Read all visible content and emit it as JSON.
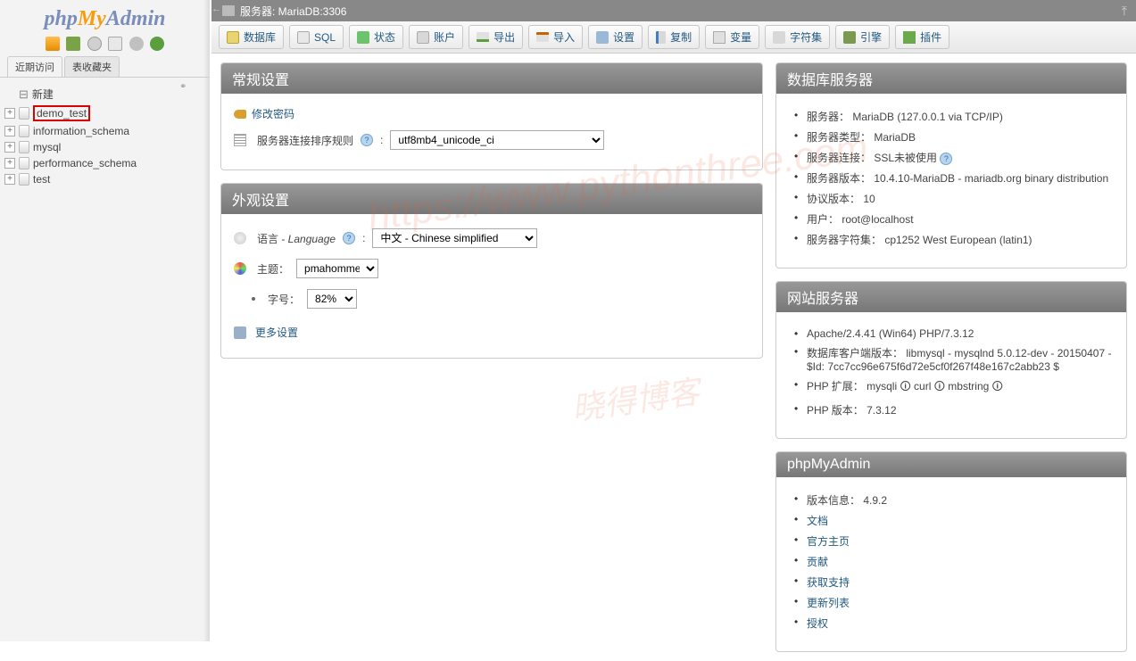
{
  "logo": {
    "php": "php",
    "my": "My",
    "admin": "Admin"
  },
  "sidebar": {
    "tabs": {
      "recent": "近期访问",
      "favorites": "表收藏夹"
    },
    "new": "新建",
    "databases": [
      "demo_test",
      "information_schema",
      "mysql",
      "performance_schema",
      "test"
    ]
  },
  "breadcrumb": {
    "server_label": "服务器: MariaDB:3306"
  },
  "topnav": {
    "databases": "数据库",
    "sql": "SQL",
    "status": "状态",
    "users": "账户",
    "export": "导出",
    "import": "导入",
    "settings": "设置",
    "replication": "复制",
    "variables": "变量",
    "charsets": "字符集",
    "engines": "引擎",
    "plugins": "插件"
  },
  "general": {
    "title": "常规设置",
    "change_password": "修改密码",
    "collation_label": "服务器连接排序规则",
    "collation_value": "utf8mb4_unicode_ci"
  },
  "appearance": {
    "title": "外观设置",
    "language_label": "语言 - ",
    "language_label2": "Language",
    "language_value": "中文 - Chinese simplified",
    "theme_label": "主题：",
    "theme_value": "pmahomme",
    "fontsize_label": "字号：",
    "fontsize_value": "82%",
    "more_settings": "更多设置"
  },
  "dbserver": {
    "title": "数据库服务器",
    "items": [
      "服务器： MariaDB (127.0.0.1 via TCP/IP)",
      "服务器类型： MariaDB",
      "服务器连接： SSL未被使用",
      "服务器版本： 10.4.10-MariaDB - mariadb.org binary distribution",
      "协议版本： 10",
      "用户： root@localhost",
      "服务器字符集： cp1252 West European (latin1)"
    ]
  },
  "webserver": {
    "title": "网站服务器",
    "items": [
      "Apache/2.4.41 (Win64) PHP/7.3.12",
      "数据库客户端版本： libmysql - mysqlnd 5.0.12-dev - 20150407 - $Id: 7cc7cc96e675f6d72e5cf0f267f48e167c2abb23 $",
      "PHP 扩展： mysqli 🛈 curl 🛈 mbstring 🛈",
      "PHP 版本： 7.3.12"
    ]
  },
  "pma": {
    "title": "phpMyAdmin",
    "version_label": "版本信息： 4.9.2",
    "links": [
      "文档",
      "官方主页",
      "贡献",
      "获取支持",
      "更新列表",
      "授权"
    ]
  },
  "watermark": {
    "t1": "https://www.pythonthree.com",
    "t2": "晓得博客"
  }
}
